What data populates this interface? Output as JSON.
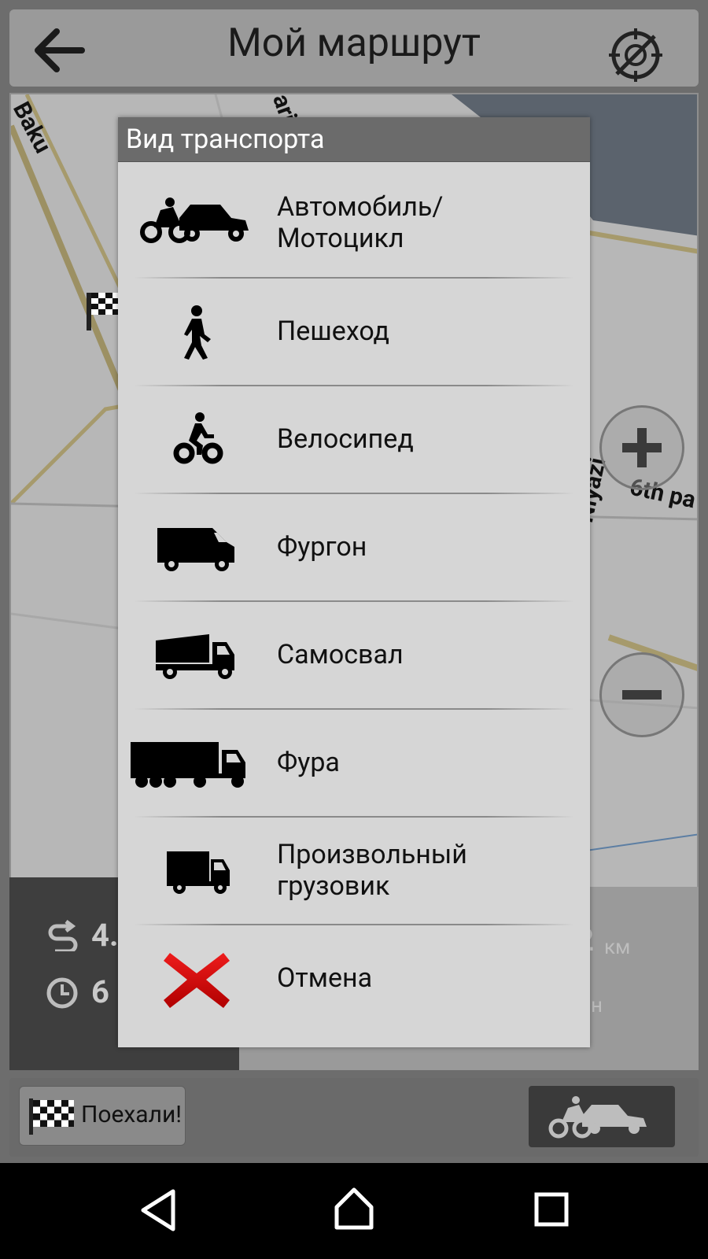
{
  "header": {
    "title": "Мой маршрут",
    "back_icon": "arrow-back-icon",
    "gps_icon": "gps-off-icon"
  },
  "map": {
    "labels": [
      "Baku",
      "ari",
      "Niyazi",
      "6th pa"
    ]
  },
  "info": {
    "distance_value": "4.",
    "time_value": "6",
    "distance_right": "2",
    "distance_unit": "км",
    "time_unit": "ин"
  },
  "dialog": {
    "title": "Вид транспорта",
    "options": [
      {
        "label_line1": "Автомобиль/",
        "label_line2": "Мотоцикл",
        "icon": "car-motorcycle-icon"
      },
      {
        "label_line1": "Пешеход",
        "label_line2": "",
        "icon": "pedestrian-icon"
      },
      {
        "label_line1": "Велосипед",
        "label_line2": "",
        "icon": "bicycle-icon"
      },
      {
        "label_line1": "Фургон",
        "label_line2": "",
        "icon": "van-icon"
      },
      {
        "label_line1": "Самосвал",
        "label_line2": "",
        "icon": "dump-truck-icon"
      },
      {
        "label_line1": "Фура",
        "label_line2": "",
        "icon": "semi-truck-icon"
      },
      {
        "label_line1": "Произвольный",
        "label_line2": "грузовик",
        "icon": "truck-icon"
      },
      {
        "label_line1": "Отмена",
        "label_line2": "",
        "icon": "cancel-icon"
      }
    ]
  },
  "bottom": {
    "go_label": "Поехали!"
  },
  "colors": {
    "accent_cancel": "#d40000",
    "dialog_header": "#6b6b6b",
    "dialog_body": "#d6d6d6"
  }
}
